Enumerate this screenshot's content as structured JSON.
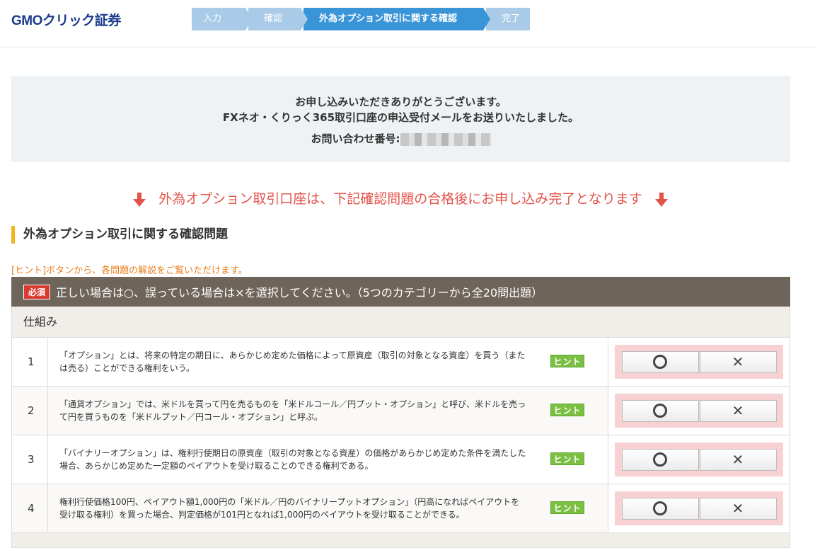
{
  "header": {
    "logo": "GMOクリック証券",
    "steps": [
      "入力",
      "確認",
      "外為オプション取引に関する確認",
      "完了"
    ]
  },
  "thanks": {
    "line1": "お申し込みいただきありがとうございます。",
    "line2": "FXネオ・くりっく365取引口座の申込受付メールをお送りいたしました。",
    "line3_label": "お問い合わせ番号:"
  },
  "notice": "外為オプション取引口座は、下記確認問題の合格後にお申し込み完了となります",
  "section_title": "外為オプション取引に関する確認問題",
  "hint_note": "[ヒント]ボタンから、各問題の解説をご覧いただけます。",
  "quiz": {
    "required_badge": "必須",
    "instruction": "正しい場合は○、誤っている場合は×を選択してください。（5つのカテゴリーから全20問出題）",
    "category": "仕組み",
    "hint_label": "ヒント",
    "questions": [
      {
        "num": "1",
        "text": "「オプション」とは、将来の特定の期日に、あらかじめ定めた価格によって原資産（取引の対象となる資産）を買う（または売る）ことができる権利をいう。"
      },
      {
        "num": "2",
        "text": "「通貨オプション」では、米ドルを買って円を売るものを「米ドルコール／円プット・オプション」と呼び、米ドルを売って円を買うものを「米ドルプット／円コール・オプション」と呼ぶ。"
      },
      {
        "num": "3",
        "text": "「バイナリーオプション」は、権利行使期日の原資産（取引の対象となる資産）の価格があらかじめ定めた条件を満たした場合、あらかじめ定めた一定額のペイアウトを受け取ることのできる権利である。"
      },
      {
        "num": "4",
        "text": "権利行使価格100円、ペイアウト額1,000円の「米ドル／円のバイナリープットオプション」（円高になればペイアウトを受け取る権利）を買った場合、判定価格が101円となれば1,000円のペイアウトを受け取ることができる。"
      }
    ]
  },
  "colors": {
    "accent_blue": "#3a95d8",
    "step_inactive": "#a9cbe8",
    "notice_red": "#e2534a",
    "hint_green": "#7bc043",
    "table_header": "#6f645a"
  }
}
